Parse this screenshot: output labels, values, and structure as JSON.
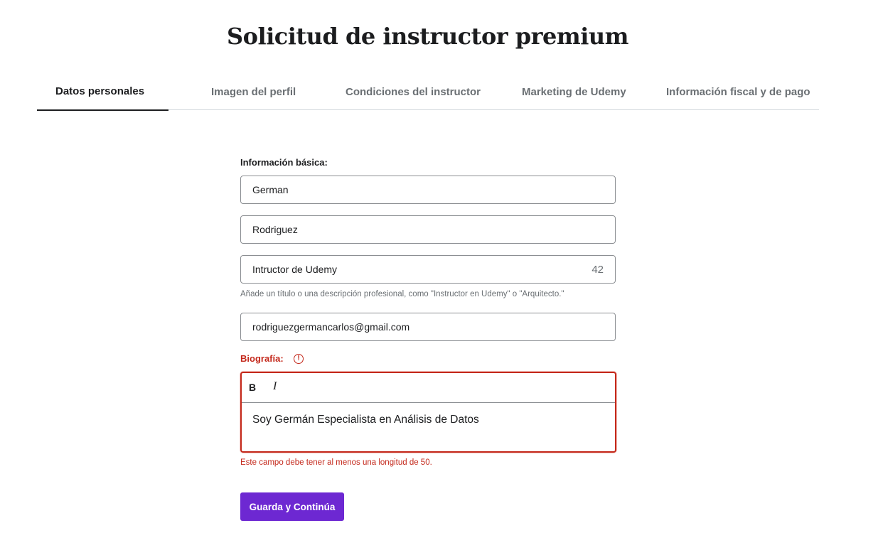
{
  "page": {
    "title": "Solicitud de instructor premium"
  },
  "tabs": [
    {
      "label": "Datos personales",
      "active": true
    },
    {
      "label": "Imagen del perfil",
      "active": false
    },
    {
      "label": "Condiciones del instructor",
      "active": false
    },
    {
      "label": "Marketing de Udemy",
      "active": false
    },
    {
      "label": "Información fiscal y de pago",
      "active": false
    }
  ],
  "form": {
    "basic_info_label": "Información básica:",
    "first_name": "German",
    "last_name": "Rodriguez",
    "headline": {
      "value": "Intructor de Udemy",
      "remaining_chars": "42",
      "helper": "Añade un título o una descripción profesional, como \"Instructor en Udemy\" o \"Arquitecto.\""
    },
    "email": "rodriguezgermancarlos@gmail.com",
    "biography": {
      "label": "Biografía:",
      "warning_symbol": "!",
      "toolbar": {
        "bold": "B",
        "italic": "I"
      },
      "value": "Soy Germán Especialista en Análisis de Datos",
      "error": "Este campo debe tener al menos una longitud de 50."
    },
    "submit_label": "Guarda y Continúa"
  },
  "colors": {
    "primary": "#6d28d2",
    "error": "#c4291c",
    "text": "#1c1d1f",
    "muted": "#6a6f73",
    "border": "#8c8f93"
  }
}
